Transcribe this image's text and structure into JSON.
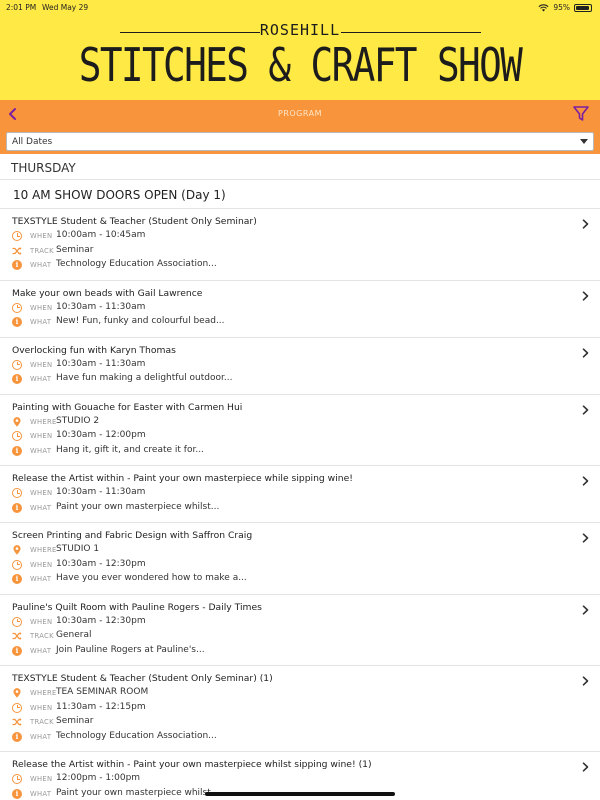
{
  "status_bar": {
    "time": "2:01 PM",
    "date": "Wed May 29",
    "battery": "95%",
    "battery_level": 0.95
  },
  "header": {
    "logo_top": "ROSEHILL",
    "logo_main": "STITCHES & CRAFT SHOW"
  },
  "navbar": {
    "title": "PROGRAM"
  },
  "date_filter": {
    "value": "All Dates"
  },
  "colors": {
    "brand_yellow": "#ffe944",
    "brand_orange": "#f7943c"
  },
  "list": {
    "day": "THURSDAY",
    "time_header": "10 AM SHOW DOORS OPEN (Day 1)",
    "events": [
      {
        "title": "TEXSTYLE Student & Teacher (Student Only Seminar)",
        "rows": [
          {
            "icon": "clock-icon",
            "label": "WHEN",
            "value": "10:00am - 10:45am"
          },
          {
            "icon": "shuffle-icon",
            "label": "TRACK",
            "value": "Seminar"
          },
          {
            "icon": "info-icon",
            "label": "WHAT",
            "value": "Technology Education Association..."
          }
        ]
      },
      {
        "title": "Make your own beads with Gail Lawrence",
        "rows": [
          {
            "icon": "clock-icon",
            "label": "WHEN",
            "value": "10:30am - 11:30am"
          },
          {
            "icon": "info-icon",
            "label": "WHAT",
            "value": "New! Fun, funky and colourful bead..."
          }
        ]
      },
      {
        "title": "Overlocking fun with Karyn Thomas",
        "rows": [
          {
            "icon": "clock-icon",
            "label": "WHEN",
            "value": "10:30am - 11:30am"
          },
          {
            "icon": "info-icon",
            "label": "WHAT",
            "value": "Have fun making a delightful outdoor..."
          }
        ]
      },
      {
        "title": "Painting with Gouache for Easter with Carmen Hui",
        "rows": [
          {
            "icon": "location-pin-icon",
            "label": "WHERE",
            "value": "STUDIO 2"
          },
          {
            "icon": "clock-icon",
            "label": "WHEN",
            "value": "10:30am - 12:00pm"
          },
          {
            "icon": "info-icon",
            "label": "WHAT",
            "value": "Hang it, gift it, and create it for..."
          }
        ]
      },
      {
        "title": "Release the Artist within - Paint your own masterpiece while sipping wine!",
        "rows": [
          {
            "icon": "clock-icon",
            "label": "WHEN",
            "value": "10:30am - 11:30am"
          },
          {
            "icon": "info-icon",
            "label": "WHAT",
            "value": "Paint your own masterpiece whilst..."
          }
        ]
      },
      {
        "title": "Screen Printing and Fabric Design with Saffron Craig",
        "rows": [
          {
            "icon": "location-pin-icon",
            "label": "WHERE",
            "value": "STUDIO 1"
          },
          {
            "icon": "clock-icon",
            "label": "WHEN",
            "value": "10:30am - 12:30pm"
          },
          {
            "icon": "info-icon",
            "label": "WHAT",
            "value": "Have you ever wondered how to make a..."
          }
        ]
      },
      {
        "title": "Pauline's Quilt Room with Pauline Rogers - Daily Times",
        "rows": [
          {
            "icon": "clock-icon",
            "label": "WHEN",
            "value": "10:30am - 12:30pm"
          },
          {
            "icon": "shuffle-icon",
            "label": "TRACK",
            "value": "General"
          },
          {
            "icon": "info-icon",
            "label": "WHAT",
            "value": "Join Pauline Rogers at Pauline's..."
          }
        ]
      },
      {
        "title": "TEXSTYLE Student & Teacher (Student Only Seminar) (1)",
        "rows": [
          {
            "icon": "location-pin-icon",
            "label": "WHERE",
            "value": "TEA SEMINAR ROOM"
          },
          {
            "icon": "clock-icon",
            "label": "WHEN",
            "value": "11:30am - 12:15pm"
          },
          {
            "icon": "shuffle-icon",
            "label": "TRACK",
            "value": "Seminar"
          },
          {
            "icon": "info-icon",
            "label": "WHAT",
            "value": "Technology Education Association..."
          }
        ]
      },
      {
        "title": "Release the Artist within - Paint your own masterpiece whilst sipping wine! (1)",
        "rows": [
          {
            "icon": "clock-icon",
            "label": "WHEN",
            "value": "12:00pm - 1:00pm"
          },
          {
            "icon": "info-icon",
            "label": "WHAT",
            "value": "Paint your own masterpiece whilst..."
          }
        ]
      }
    ]
  }
}
